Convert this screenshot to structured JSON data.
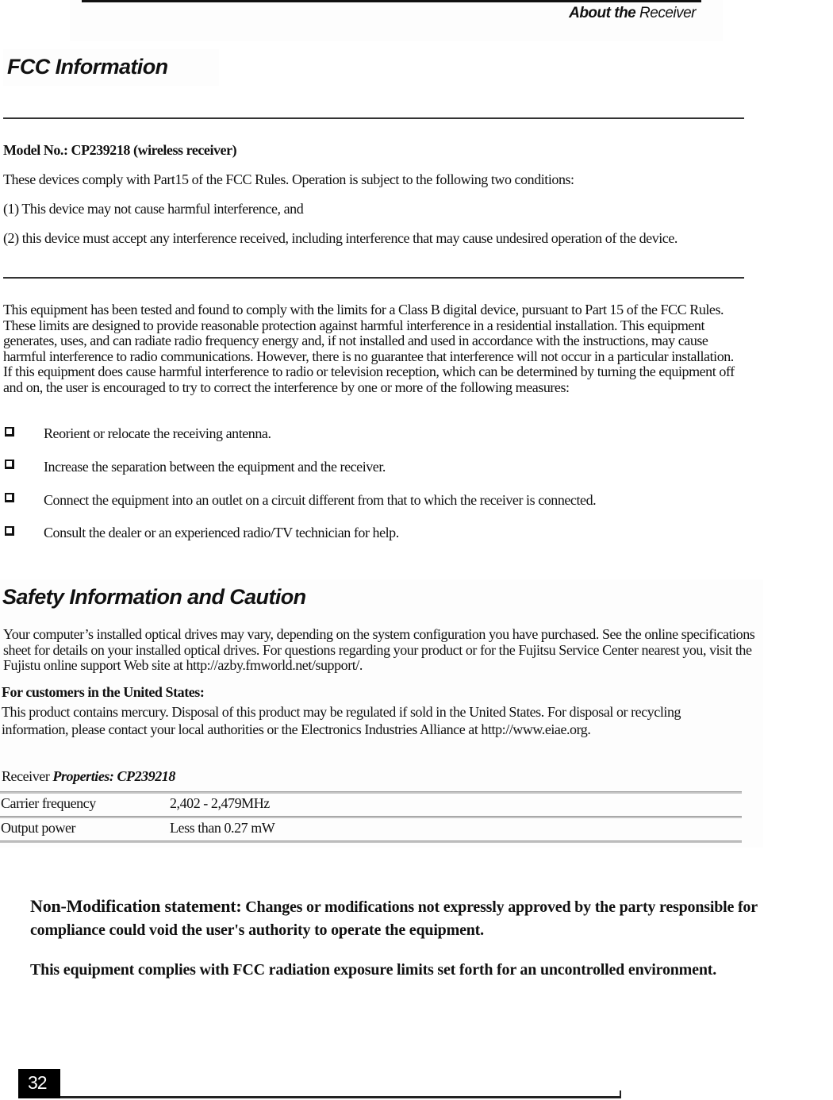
{
  "header": {
    "running_title_bold": "About the",
    "running_title_rest": " Receiver"
  },
  "fcc": {
    "title": "FCC Information",
    "model": "Model No.: CP239218 (wireless receiver)",
    "compliance": "These devices comply with Part15 of the FCC Rules. Operation is subject to the following two conditions:",
    "condition_1": "(1) This device may not cause harmful interference, and",
    "condition_2": "(2) this device must accept any interference received, including interference that may cause undesired operation of the device.",
    "class_b_paragraph": "This equipment has been tested and found to comply with the limits for a Class B digital device, pursuant to Part 15 of the FCC Rules. These limits are designed to provide reasonable protection against harmful interference in a residential installation. This equipment generates, uses, and can radiate radio frequency energy and, if not installed and used in accordance with the instructions, may cause harmful interference to radio communications. However, there is no guarantee that interference will not occur in a particular installation. If this equipment does cause harmful interference to radio or television reception, which can be determined by turning the equipment off and on, the user is encouraged to try to correct the interference by one or more of the following measures:",
    "measures": [
      "Reorient or relocate the receiving antenna.",
      "Increase the separation between the equipment and the receiver.",
      "Connect the equipment into an outlet on a circuit different from that to which the receiver is connected.",
      "Consult the dealer or an experienced radio/TV technician for help."
    ]
  },
  "safety": {
    "title": "Safety Information and Caution",
    "optical_paragraph": "Your computer’s installed optical drives may vary, depending on the system configuration you have purchased. See the online specifications sheet for details on your installed optical drives. For questions regarding your product or for the Fujitsu Service Center nearest you, visit the Fujistu online support Web site at http://azby.fmworld.net/support/.",
    "us_heading": "For customers in the United States:",
    "mercury_paragraph": "This product contains mercury. Disposal of this product may be regulated if sold in the United States. For disposal or recycling information, please contact your local authorities or the Electronics Industries Alliance at http://www.eiae.org.",
    "properties_label": "Receiver ",
    "properties_italic": "Properties: CP239218",
    "properties": [
      {
        "name": "Carrier frequency",
        "value": "2,402 - 2,479MHz"
      },
      {
        "name": "Output power",
        "value": "Less than 0.27 mW"
      }
    ]
  },
  "statements": {
    "nonmod_lead": "Non-Modification statement:",
    "nonmod_body": " Changes or modifications not expressly approved by the party responsible for compliance could void the user's authority to operate the equipment.",
    "exposure": "This equipment complies with FCC radiation exposure limits set forth for an uncontrolled environment."
  },
  "footer": {
    "page_number": "32"
  }
}
